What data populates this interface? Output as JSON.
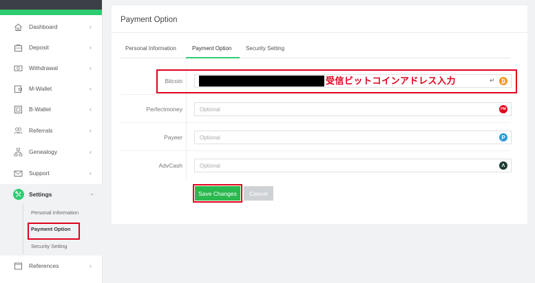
{
  "sidebar": {
    "items": [
      {
        "label": "Dashboard",
        "icon": "home-icon"
      },
      {
        "label": "Deposit",
        "icon": "briefcase-icon"
      },
      {
        "label": "Withdrawal",
        "icon": "cash-icon"
      },
      {
        "label": "M-Wallet",
        "icon": "wallet-icon"
      },
      {
        "label": "B-Wallet",
        "icon": "box-icon"
      },
      {
        "label": "Referrals",
        "icon": "users-icon"
      },
      {
        "label": "Genealogy",
        "icon": "tree-icon"
      },
      {
        "label": "Support",
        "icon": "mail-icon"
      },
      {
        "label": "Settings",
        "icon": "settings-icon"
      },
      {
        "label": "References",
        "icon": "book-icon"
      }
    ],
    "chevron": "‹",
    "chevron_open": "⌄",
    "settings_sub": [
      {
        "label": "Personal Information"
      },
      {
        "label": "Payment Option"
      },
      {
        "label": "Security Setting"
      }
    ]
  },
  "page": {
    "title": "Payment Option",
    "tabs": [
      {
        "label": "Personal Information"
      },
      {
        "label": "Payment Option"
      },
      {
        "label": "Security Setting"
      }
    ]
  },
  "form": {
    "fields": [
      {
        "label": "Bitcoin",
        "placeholder": "",
        "icon": "bitcoin-icon",
        "icon_glyph": "₿",
        "color": "#f7931a"
      },
      {
        "label": "Perfectmoney",
        "placeholder": "Optional",
        "icon": "perfectmoney-icon",
        "icon_glyph": "PM",
        "color": "#e0001b"
      },
      {
        "label": "Payeer",
        "placeholder": "Optional",
        "icon": "payeer-icon",
        "icon_glyph": "P",
        "color": "#2a9bd8"
      },
      {
        "label": "AdvCash",
        "placeholder": "Optional",
        "icon": "advcash-icon",
        "icon_glyph": "Λ",
        "color": "#1e3a34"
      }
    ],
    "annotation": "受信ビットコインアドレス入力",
    "return_mark": "↵",
    "save_label": "Save Changes",
    "cancel_label": "Cancel"
  },
  "colors": {
    "accent": "#2ecc71",
    "annotation_red": "#e0001b",
    "sidebar_dark": "#3c4046"
  }
}
